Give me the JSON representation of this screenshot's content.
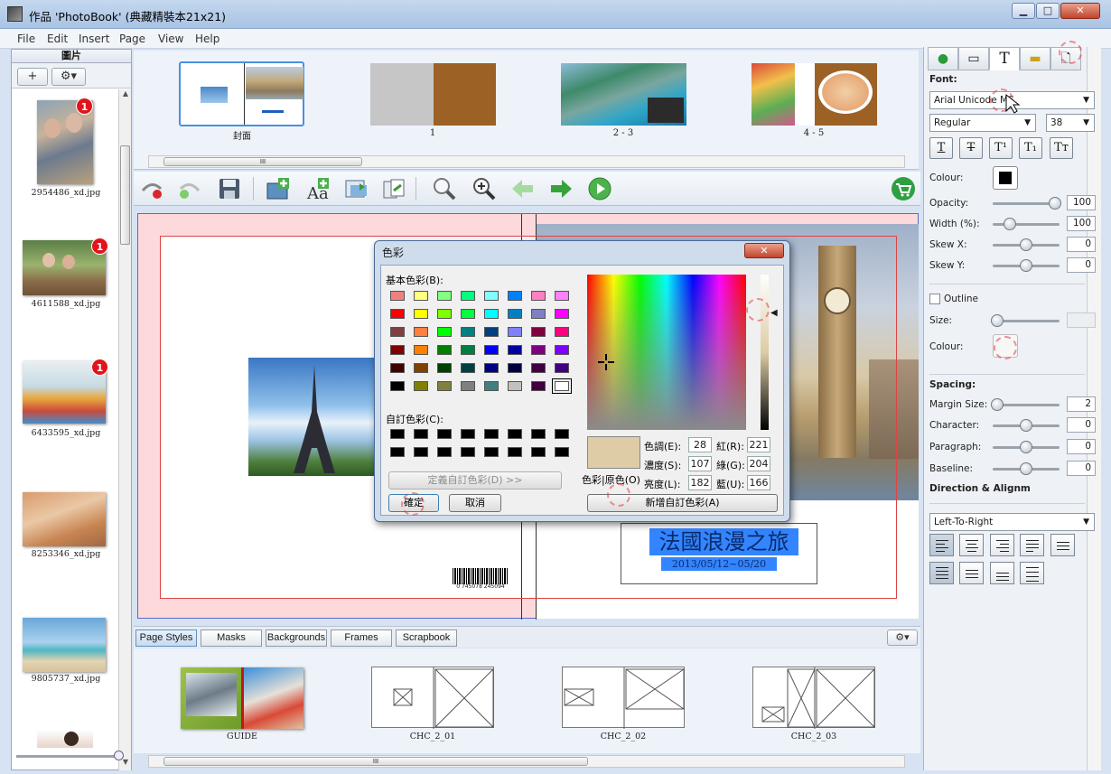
{
  "window": {
    "title": "作品 'PhotoBook' (典藏精裝本21x21)",
    "btn_min": "▁",
    "btn_max": "□",
    "btn_close": "✕"
  },
  "menu": [
    "File",
    "Edit",
    "Insert",
    "Page",
    "View",
    "Help"
  ],
  "left_panel": {
    "header": "圖片",
    "add_label": "+",
    "images": [
      {
        "name": "2954486_xd.jpg",
        "badge": "1"
      },
      {
        "name": "4611588_xd.jpg",
        "badge": "1"
      },
      {
        "name": "6433595_xd.jpg",
        "badge": "1"
      },
      {
        "name": "8253346_xd.jpg",
        "badge": ""
      },
      {
        "name": "9805737_xd.jpg",
        "badge": ""
      }
    ]
  },
  "pages": [
    {
      "label": "封面"
    },
    {
      "label": "1"
    },
    {
      "label": "2 - 3"
    },
    {
      "label": "4 - 5"
    }
  ],
  "scroll_grip": "III",
  "canvas": {
    "title_text": "法國浪漫之旅",
    "date_text": "2013/05/12~05/20",
    "barcode_digits": "0 745078 245094"
  },
  "dialog": {
    "title": "色彩",
    "basic_label": "基本色彩(B):",
    "custom_label": "自訂色彩(C):",
    "define_button": "定義自訂色彩(D) >>",
    "ok_button": "確定",
    "cancel_button": "取消",
    "solid_label": "色彩|原色(O)",
    "add_button": "新增自訂色彩(A)",
    "hue_label": "色調(E):",
    "hue_value": "28",
    "sat_label": "濃度(S):",
    "sat_value": "107",
    "lum_label": "亮度(L):",
    "lum_value": "182",
    "red_label": "紅(R):",
    "red_value": "221",
    "green_label": "綠(G):",
    "green_value": "204",
    "blue_label": "藍(U):",
    "blue_value": "166",
    "current_color": "#ddccA6",
    "basic_colors": [
      "#f08080",
      "#ffff80",
      "#80ff80",
      "#00ff80",
      "#80ffff",
      "#0080ff",
      "#ff80c0",
      "#ff80ff",
      "#ff0000",
      "#ffff00",
      "#80ff00",
      "#00ff40",
      "#00ffff",
      "#0080c0",
      "#8080c0",
      "#ff00ff",
      "#804040",
      "#ff8040",
      "#00ff00",
      "#008080",
      "#004080",
      "#8080ff",
      "#800040",
      "#ff0080",
      "#800000",
      "#ff8000",
      "#008000",
      "#008040",
      "#0000ff",
      "#0000a0",
      "#800080",
      "#8000ff",
      "#400000",
      "#804000",
      "#004000",
      "#004040",
      "#000080",
      "#000040",
      "#400040",
      "#400080",
      "#000000",
      "#808000",
      "#808040",
      "#808080",
      "#408080",
      "#c0c0c0",
      "#400040",
      "#ffffff"
    ]
  },
  "right_panel": {
    "font_label": "Font:",
    "font_value": "Arial Unicode MS",
    "style_value": "Regular",
    "size_value": "38",
    "format_buttons": [
      "T",
      "T",
      "T¹",
      "T₁",
      "Tт"
    ],
    "colour_label": "Colour:",
    "opacity_label": "Opacity:",
    "opacity_value": "100",
    "width_label": "Width (%):",
    "width_value": "100",
    "skewx_label": "Skew X:",
    "skewx_value": "0",
    "skewy_label": "Skew Y:",
    "skewy_value": "0",
    "outline_label": "Outline",
    "size_label": "Size:",
    "outline_colour_label": "Colour:",
    "spacing_label": "Spacing:",
    "margin_label": "Margin Size:",
    "margin_value": "2",
    "character_label": "Character:",
    "character_value": "0",
    "paragraph_label": "Paragraph:",
    "paragraph_value": "0",
    "baseline_label": "Baseline:",
    "baseline_value": "0",
    "direction_label": "Direction & Alignm",
    "direction_value": "Left-To-Right"
  },
  "bottom_tabs": [
    "Page Styles",
    "Masks",
    "Backgrounds",
    "Frames",
    "Scrapbook"
  ],
  "styles": [
    {
      "label": "GUIDE"
    },
    {
      "label": "CHC_2_01"
    },
    {
      "label": "CHC_2_02"
    },
    {
      "label": "CHC_2_03"
    }
  ]
}
